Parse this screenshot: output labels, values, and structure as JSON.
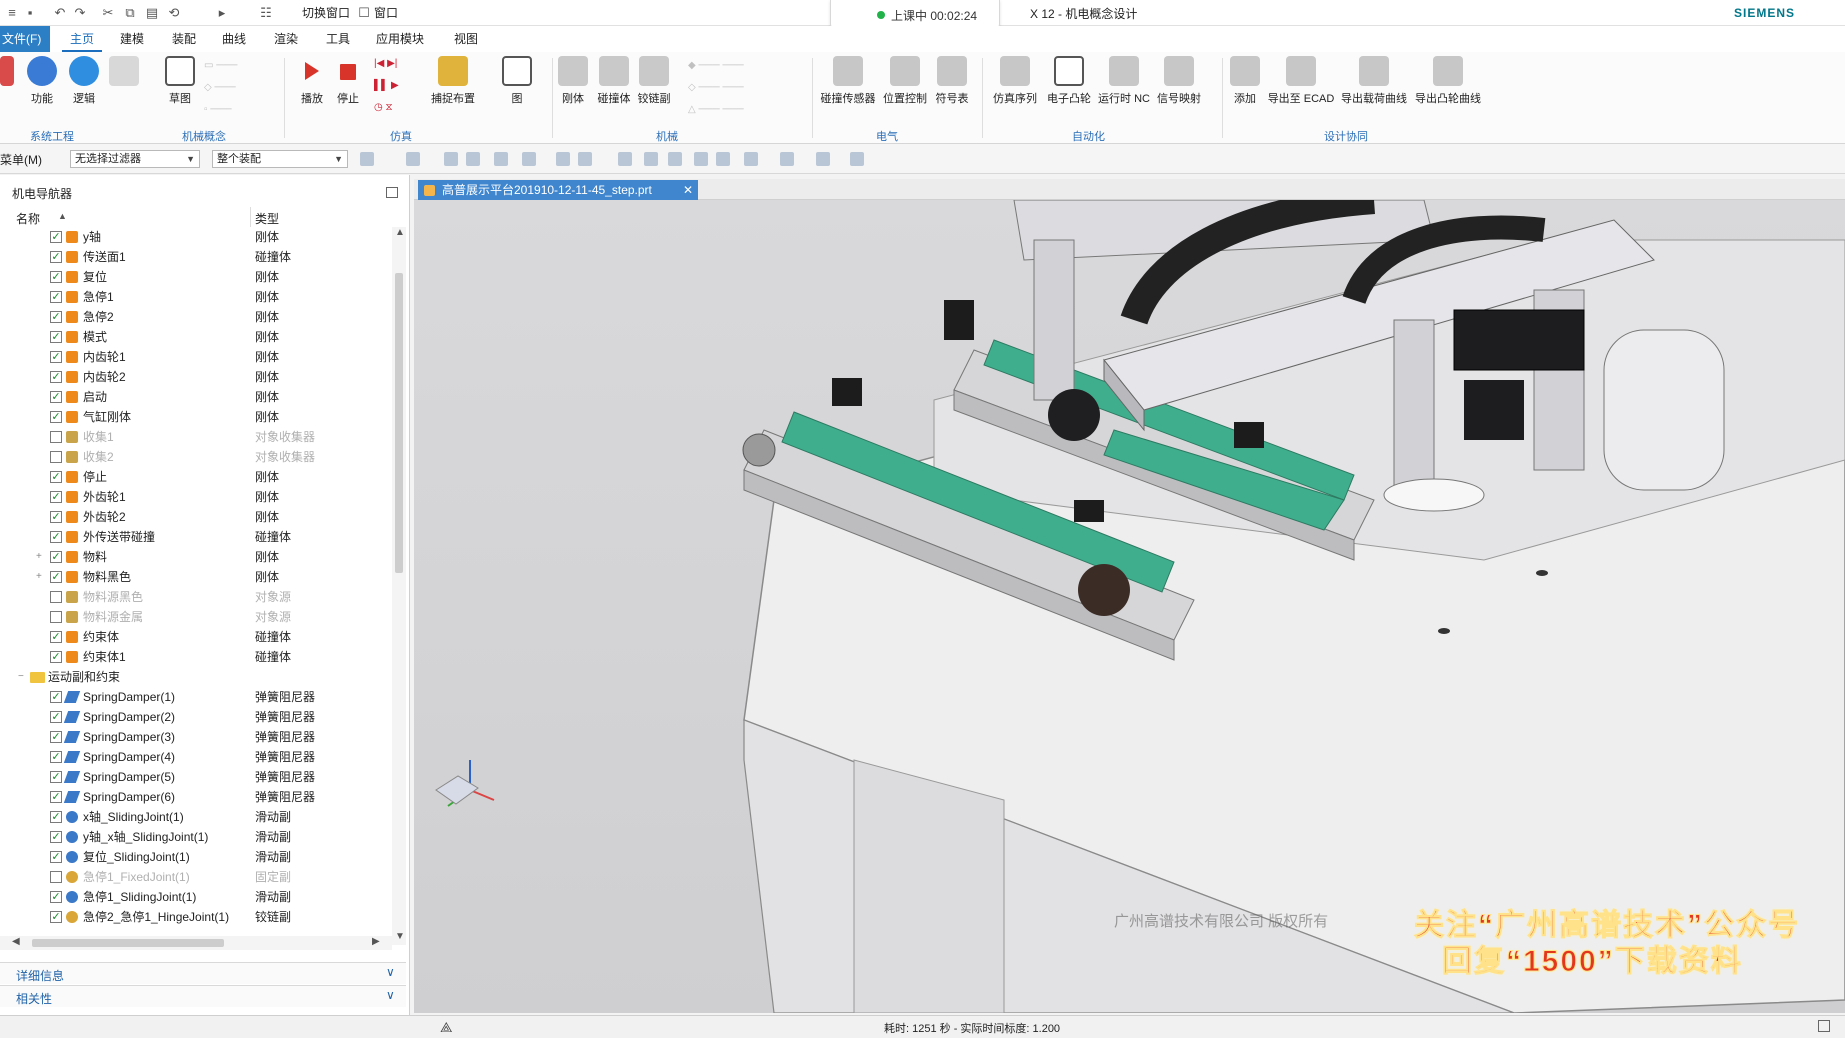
{
  "titlebar": {
    "switch_window": "切换窗口",
    "window": "窗口",
    "lesson_status": "上课中 00:02:24",
    "app_title": "X 12 - 机电概念设计",
    "brand": "SIEMENS"
  },
  "menu": {
    "file": "文件(F)",
    "tabs": [
      "主页",
      "建模",
      "装配",
      "曲线",
      "渲染",
      "工具",
      "应用模块",
      "视图"
    ]
  },
  "ribbon": {
    "buttons": {
      "function": "功能",
      "logic": "逻辑",
      "sketch": "草图",
      "play": "播放",
      "stop": "停止",
      "capture_layout": "捕捉布置",
      "graph": "图",
      "rigid_body": "刚体",
      "collision_body": "碰撞体",
      "hinge": "铰链副",
      "collision_sensor": "碰撞传感器",
      "position_control": "位置控制",
      "symbol_table": "符号表",
      "sim_sequence": "仿真序列",
      "electronic_cam": "电子凸轮",
      "run_nc": "运行时 NC",
      "signal_map": "信号映射",
      "add": "添加",
      "export_ecad": "导出至 ECAD",
      "export_load_curve": "导出载荷曲线",
      "export_cam_curve": "导出凸轮曲线"
    },
    "groups": {
      "system_eng": "系统工程",
      "mech_concept": "机械概念",
      "simulation": "仿真",
      "mechanical": "机械",
      "electrical": "电气",
      "automation": "自动化",
      "design_collab": "设计协同"
    }
  },
  "filterbar": {
    "menu": "菜单(M)",
    "filter": "无选择过滤器",
    "assembly": "整个装配"
  },
  "navigator": {
    "title": "机电导航器",
    "col_name": "名称",
    "col_type": "类型",
    "rows": [
      {
        "name": "y轴",
        "type": "刚体",
        "checked": true,
        "icon": "body"
      },
      {
        "name": "传送面1",
        "type": "碰撞体",
        "checked": true,
        "icon": "body"
      },
      {
        "name": "复位",
        "type": "刚体",
        "checked": true,
        "icon": "body"
      },
      {
        "name": "急停1",
        "type": "刚体",
        "checked": true,
        "icon": "body"
      },
      {
        "name": "急停2",
        "type": "刚体",
        "checked": true,
        "icon": "body"
      },
      {
        "name": "模式",
        "type": "刚体",
        "checked": true,
        "icon": "body"
      },
      {
        "name": "内齿轮1",
        "type": "刚体",
        "checked": true,
        "icon": "body"
      },
      {
        "name": "内齿轮2",
        "type": "刚体",
        "checked": true,
        "icon": "body"
      },
      {
        "name": "启动",
        "type": "刚体",
        "checked": true,
        "icon": "body"
      },
      {
        "name": "气缸刚体",
        "type": "刚体",
        "checked": true,
        "icon": "body"
      },
      {
        "name": "收集1",
        "type": "对象收集器",
        "checked": false,
        "icon": "collect"
      },
      {
        "name": "收集2",
        "type": "对象收集器",
        "checked": false,
        "icon": "collect"
      },
      {
        "name": "停止",
        "type": "刚体",
        "checked": true,
        "icon": "body"
      },
      {
        "name": "外齿轮1",
        "type": "刚体",
        "checked": true,
        "icon": "body"
      },
      {
        "name": "外齿轮2",
        "type": "刚体",
        "checked": true,
        "icon": "body"
      },
      {
        "name": "外传送带碰撞",
        "type": "碰撞体",
        "checked": true,
        "icon": "body"
      },
      {
        "name": "物料",
        "type": "刚体",
        "checked": true,
        "icon": "body",
        "expandable": true
      },
      {
        "name": "物料黑色",
        "type": "刚体",
        "checked": true,
        "icon": "body",
        "expandable": true
      },
      {
        "name": "物料源黑色",
        "type": "对象源",
        "checked": false,
        "icon": "collect"
      },
      {
        "name": "物料源金属",
        "type": "对象源",
        "checked": false,
        "icon": "collect"
      },
      {
        "name": "约束体",
        "type": "碰撞体",
        "checked": true,
        "icon": "body"
      },
      {
        "name": "约束体1",
        "type": "碰撞体",
        "checked": true,
        "icon": "body"
      },
      {
        "name": "运动副和约束",
        "type": "",
        "group": true
      },
      {
        "name": "SpringDamper(1)",
        "type": "弹簧阻尼器",
        "checked": true,
        "icon": "spring"
      },
      {
        "name": "SpringDamper(2)",
        "type": "弹簧阻尼器",
        "checked": true,
        "icon": "spring"
      },
      {
        "name": "SpringDamper(3)",
        "type": "弹簧阻尼器",
        "checked": true,
        "icon": "spring"
      },
      {
        "name": "SpringDamper(4)",
        "type": "弹簧阻尼器",
        "checked": true,
        "icon": "spring"
      },
      {
        "name": "SpringDamper(5)",
        "type": "弹簧阻尼器",
        "checked": true,
        "icon": "spring"
      },
      {
        "name": "SpringDamper(6)",
        "type": "弹簧阻尼器",
        "checked": true,
        "icon": "spring"
      },
      {
        "name": "x轴_SlidingJoint(1)",
        "type": "滑动副",
        "checked": true,
        "icon": "joint"
      },
      {
        "name": "y轴_x轴_SlidingJoint(1)",
        "type": "滑动副",
        "checked": true,
        "icon": "joint"
      },
      {
        "name": "复位_SlidingJoint(1)",
        "type": "滑动副",
        "checked": true,
        "icon": "joint"
      },
      {
        "name": "急停1_FixedJoint(1)",
        "type": "固定副",
        "checked": false,
        "icon": "hinge"
      },
      {
        "name": "急停1_SlidingJoint(1)",
        "type": "滑动副",
        "checked": true,
        "icon": "joint"
      },
      {
        "name": "急停2_急停1_HingeJoint(1)",
        "type": "铰链副",
        "checked": true,
        "icon": "hinge"
      }
    ],
    "details": "详细信息",
    "dependencies": "相关性"
  },
  "document": {
    "tab": "高普展示平台201910-12-11-45_step.prt"
  },
  "viewport": {
    "copyright": "广州高谱技术有限公司 版权所有",
    "promo_line1": "关注“广州高谱技术”公众号",
    "promo_line2": "回复“1500”下载资料",
    "logo_text": "高谱"
  },
  "status": {
    "text": "耗时: 1251 秒 - 实际时间标度: 1.200"
  },
  "colors": {
    "accent": "#2c7ec5",
    "belt": "#3fae8c",
    "check": "#1a8c2a",
    "body_icon": "#ee8a1c",
    "promo": "#e2371f"
  }
}
